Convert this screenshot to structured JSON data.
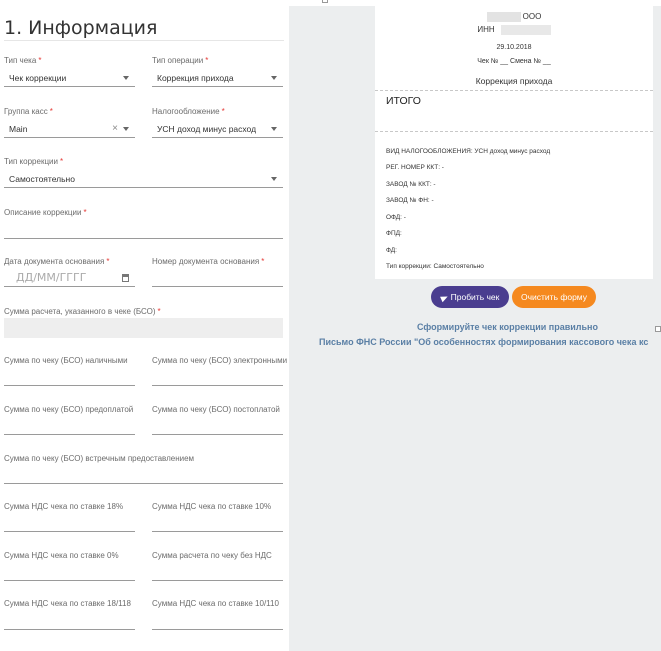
{
  "form": {
    "title": "1. Информация",
    "check_type": {
      "label": "Тип чека",
      "value": "Чек коррекции"
    },
    "operation_type": {
      "label": "Тип операции",
      "value": "Коррекция прихода"
    },
    "cash_group": {
      "label": "Группа касс",
      "value": "Main",
      "clear": "×"
    },
    "taxation": {
      "label": "Налогообложение",
      "value": "УСН доход минус расход"
    },
    "correction_type": {
      "label": "Тип коррекции",
      "value": "Самостоятельно"
    },
    "correction_description": {
      "label": "Описание коррекции"
    },
    "base_doc_date": {
      "label": "Дата документа основания",
      "placeholder": "ДД/ММ/ГГГГ"
    },
    "base_doc_number": {
      "label": "Номер документа основания"
    },
    "calc_sum": {
      "label": "Сумма расчета, указанного в чеке (БСО)"
    },
    "sum_cash": {
      "label": "Сумма по чеку (БСО) наличными"
    },
    "sum_electronic": {
      "label": "Сумма по чеку (БСО) электронными"
    },
    "sum_prepaid": {
      "label": "Сумма по чеку (БСО) предоплатой"
    },
    "sum_postpaid": {
      "label": "Сумма по чеку (БСО) постоплатой"
    },
    "sum_counter": {
      "label": "Сумма по чеку (БСО) встречным предоставлением"
    },
    "vat18": {
      "label": "Сумма НДС чека по ставке 18%"
    },
    "vat10": {
      "label": "Сумма НДС чека по ставке 10%"
    },
    "vat0": {
      "label": "Сумма НДС чека по ставке 0%"
    },
    "no_vat": {
      "label": "Сумма расчета по чеку без НДС"
    },
    "vat18_118": {
      "label": "Сумма НДС чека по ставке 18/118"
    },
    "vat10_110": {
      "label": "Сумма НДС чека по ставке 10/110"
    },
    "required_mark": "*"
  },
  "receipt": {
    "org": "ООО",
    "inn": "ИНН",
    "date": "29.10.2018",
    "shift": "Чек № __ Смена № __",
    "type": "Коррекция прихода",
    "total": "ИТОГО",
    "lines": [
      "ВИД НАЛОГООБЛОЖЕНИЯ: УСН доход минус расход",
      "РЕГ. НОМЕР ККТ: -",
      "ЗАВОД № ККТ: -",
      "ЗАВОД № ФН: -",
      "ОФД: -",
      "ФПД:",
      "ФД:",
      "Тип коррекции: Самостоятельно"
    ]
  },
  "actions": {
    "print": "Пробить чек",
    "clear": "Очистить форму"
  },
  "links": {
    "guide": "Сформируйте чек коррекции правильно",
    "letter": "Письмо ФНС России \"Об особенностях формирования кассового чека кс"
  },
  "colors": {
    "primary": "#4a3d8f",
    "secondary": "#f5891f",
    "link": "#5a7fa5",
    "required": "#e53935"
  },
  "icons": {
    "print": "paper-plane-icon",
    "date": "calendar-icon",
    "select": "chevron-down-icon"
  }
}
